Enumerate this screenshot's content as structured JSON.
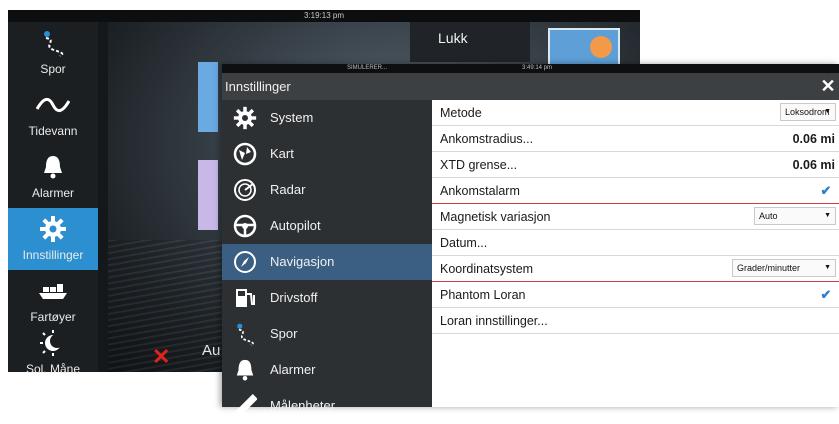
{
  "background": {
    "topbar_time": "3:19:13 pm",
    "close_label": "Lukk",
    "partial_text": "Au"
  },
  "sidebar": {
    "items": [
      {
        "label": "Spor",
        "icon": "track-icon"
      },
      {
        "label": "Tidevann",
        "icon": "wave-icon"
      },
      {
        "label": "Alarmer",
        "icon": "bell-icon"
      },
      {
        "label": "Innstillinger",
        "icon": "gear-icon",
        "active": true
      },
      {
        "label": "Fartøyer",
        "icon": "vessels-icon"
      },
      {
        "label": "Sol, Måne",
        "icon": "sun-moon-icon"
      }
    ]
  },
  "dialog": {
    "topbar_sim": "SIMULERER...",
    "topbar_time": "3:49:14 pm",
    "title": "Innstillinger",
    "close_glyph": "✕",
    "nav": [
      {
        "label": "System",
        "icon": "gear-icon"
      },
      {
        "label": "Kart",
        "icon": "chart-icon"
      },
      {
        "label": "Radar",
        "icon": "radar-icon"
      },
      {
        "label": "Autopilot",
        "icon": "steering-wheel-icon"
      },
      {
        "label": "Navigasjon",
        "icon": "compass-icon",
        "active": true
      },
      {
        "label": "Drivstoff",
        "icon": "fuel-pump-icon"
      },
      {
        "label": "Spor",
        "icon": "track-icon"
      },
      {
        "label": "Alarmer",
        "icon": "bell-icon"
      },
      {
        "label": "Målenheter",
        "icon": "ruler-icon"
      }
    ],
    "settings": {
      "metode": {
        "label": "Metode",
        "value": "Loksodrom"
      },
      "ankomstradius": {
        "label": "Ankomstradius...",
        "value": "0.06 mi"
      },
      "xtd": {
        "label": "XTD grense...",
        "value": "0.06 mi"
      },
      "ankomstalarm": {
        "label": "Ankomstalarm",
        "checked": true,
        "check_glyph": "✔"
      },
      "magnetisk": {
        "label": "Magnetisk variasjon",
        "value": "Auto"
      },
      "datum": {
        "label": "Datum..."
      },
      "koordinat": {
        "label": "Koordinatsystem",
        "value": "Grader/minutter"
      },
      "phantom": {
        "label": "Phantom Loran",
        "checked": true,
        "check_glyph": "✔"
      },
      "loran": {
        "label": "Loran innstillinger..."
      }
    }
  },
  "colors": {
    "accent": "#2c8fd0",
    "nav_active": "#3a5f82",
    "checkbox": "#2f82c8",
    "alarm_x": "#e0231c"
  }
}
